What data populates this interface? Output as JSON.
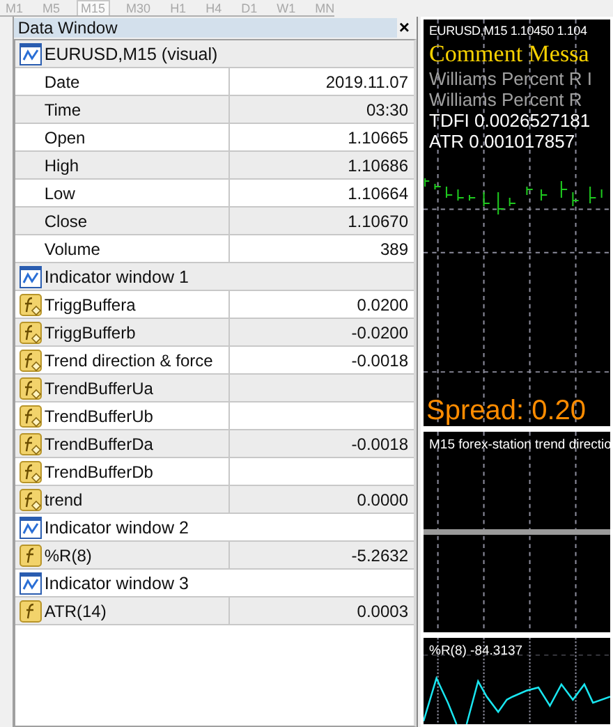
{
  "toolbar": {
    "timeframes": [
      {
        "label": "M1",
        "selected": false
      },
      {
        "label": "M5",
        "selected": false
      },
      {
        "label": "M15",
        "selected": true
      },
      {
        "label": "M30",
        "selected": false
      },
      {
        "label": "H1",
        "selected": false
      },
      {
        "label": "H4",
        "selected": false
      },
      {
        "label": "D1",
        "selected": false
      },
      {
        "label": "W1",
        "selected": false
      },
      {
        "label": "MN",
        "selected": false
      }
    ]
  },
  "data_window": {
    "title": "Data Window",
    "close": "×",
    "rows": [
      {
        "kind": "group",
        "label": "EURUSD,M15 (visual)"
      },
      {
        "kind": "value",
        "label": "Date",
        "value": "2019.11.07"
      },
      {
        "kind": "value",
        "label": "Time",
        "value": "03:30"
      },
      {
        "kind": "value",
        "label": "Open",
        "value": "1.10665"
      },
      {
        "kind": "value",
        "label": "High",
        "value": "1.10686"
      },
      {
        "kind": "value",
        "label": "Low",
        "value": "1.10664"
      },
      {
        "kind": "value",
        "label": "Close",
        "value": "1.10670"
      },
      {
        "kind": "value",
        "label": "Volume",
        "value": "389"
      },
      {
        "kind": "group",
        "label": "Indicator window 1"
      },
      {
        "kind": "buffer",
        "label": "TriggBuffera",
        "value": "0.0200"
      },
      {
        "kind": "buffer",
        "label": "TriggBufferb",
        "value": "-0.0200"
      },
      {
        "kind": "buffer",
        "label": "Trend direction & force",
        "value": "-0.0018"
      },
      {
        "kind": "buffer",
        "label": "TrendBufferUa"
      },
      {
        "kind": "buffer",
        "label": "TrendBufferUb"
      },
      {
        "kind": "buffer",
        "label": "TrendBufferDa",
        "value": "-0.0018"
      },
      {
        "kind": "buffer",
        "label": "TrendBufferDb"
      },
      {
        "kind": "buffer",
        "label": "trend",
        "value": "0.0000"
      },
      {
        "kind": "group",
        "label": "Indicator window 2"
      },
      {
        "kind": "function",
        "label": "%R(8)",
        "value": "-5.2632"
      },
      {
        "kind": "group",
        "label": "Indicator window 3"
      },
      {
        "kind": "function",
        "label": "ATR(14)",
        "value": "0.0003"
      }
    ]
  },
  "chart": {
    "header": "EURUSD,M15  1.10450 1.104",
    "comment": "Comment Messa",
    "lines": [
      {
        "kind": "dim",
        "text": "Williams Percent R I"
      },
      {
        "kind": "dim",
        "text": "Williams Percent R"
      },
      {
        "kind": "bright",
        "text": "TDFI 0.0026527181"
      },
      {
        "kind": "bright",
        "text": "ATR 0.001017857"
      }
    ],
    "spread": "Spread: 0.20",
    "subwindows": [
      {
        "kind": "trend",
        "title": "M15 forex-station trend directio"
      },
      {
        "kind": "wpr",
        "title": "%R(8) -84.3137"
      }
    ]
  }
}
